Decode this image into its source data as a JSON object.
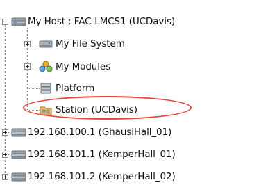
{
  "tree": {
    "root": {
      "label": "My Host : FAC-LMCS1 (UCDavis)",
      "icon": "host-computer-icon",
      "expanded": true
    },
    "children": [
      {
        "label": "My File System",
        "icon": "drive-icon",
        "expander": "plus"
      },
      {
        "label": "My Modules",
        "icon": "modules-icon",
        "expander": "plus"
      },
      {
        "label": "Platform",
        "icon": "platform-server-icon",
        "expander": "none"
      },
      {
        "label": "Station (UCDavis)",
        "icon": "station-folder-icon",
        "expander": "none",
        "highlighted": true
      }
    ],
    "hosts": [
      {
        "label": "192.168.100.1 (GhausiHall_01)",
        "icon": "host-computer-icon",
        "expander": "plus"
      },
      {
        "label": "192.168.101.1 (KemperHall_01)",
        "icon": "host-computer-icon",
        "expander": "plus"
      },
      {
        "label": "192.168.101.2 (KemperHall_02)",
        "icon": "host-computer-icon",
        "expander": "plus"
      }
    ]
  },
  "colors": {
    "highlight_ellipse": "#e8433b",
    "tree_lines": "#8a8a8a"
  }
}
